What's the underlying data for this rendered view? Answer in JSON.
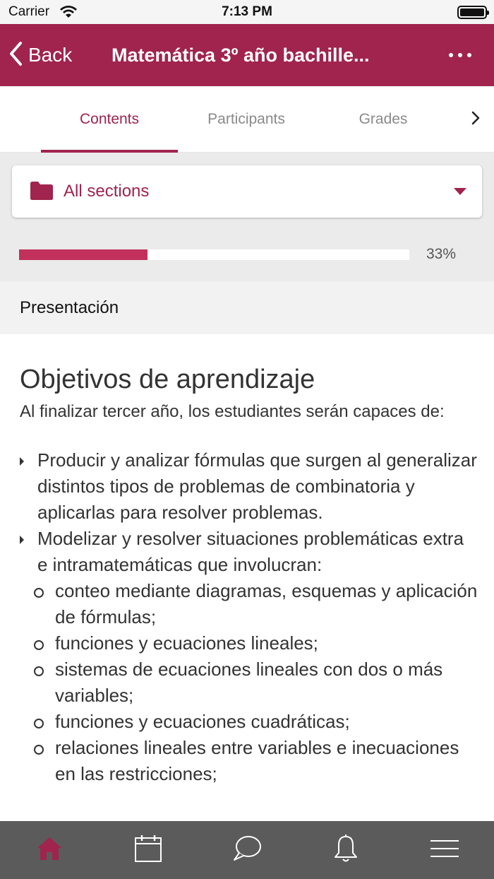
{
  "status_bar": {
    "carrier": "Carrier",
    "time": "7:13 PM"
  },
  "nav": {
    "back_label": "Back",
    "title": "Matemática 3º año bachille..."
  },
  "tabs": [
    {
      "label": "Contents",
      "active": true
    },
    {
      "label": "Participants",
      "active": false
    },
    {
      "label": "Grades",
      "active": false
    }
  ],
  "section_selector": {
    "label": "All sections",
    "icon": "folder-icon"
  },
  "progress": {
    "value": 33,
    "label": "33%"
  },
  "section_title": "Presentación",
  "content": {
    "heading": "Objetivos de aprendizaje",
    "intro": "Al finalizar tercer año, los estudiantes serán capaces de:",
    "items": [
      "Producir y analizar fórmulas que surgen al generalizar distintos tipos de problemas de combinatoria y aplicarlas para resolver problemas.",
      "Modelizar y resolver situaciones problemáticas extra e intramatemáticas que involucran:"
    ],
    "sub_items": [
      "conteo mediante diagramas, esquemas y aplicación de fórmulas;",
      "funciones y ecuaciones lineales;",
      "sistemas de ecuaciones lineales con dos o más variables;",
      "funciones y ecuaciones cuadráticas;",
      "relaciones lineales entre variables e inecuaciones en las restricciones;"
    ]
  },
  "bottom_bar": {
    "items": [
      "home-icon",
      "calendar-icon",
      "messages-icon",
      "notifications-icon",
      "menu-icon"
    ],
    "active_index": 0
  },
  "colors": {
    "brand": "#a0244d",
    "progress": "#c2305c",
    "bottom_bar": "#5b5b5b"
  }
}
